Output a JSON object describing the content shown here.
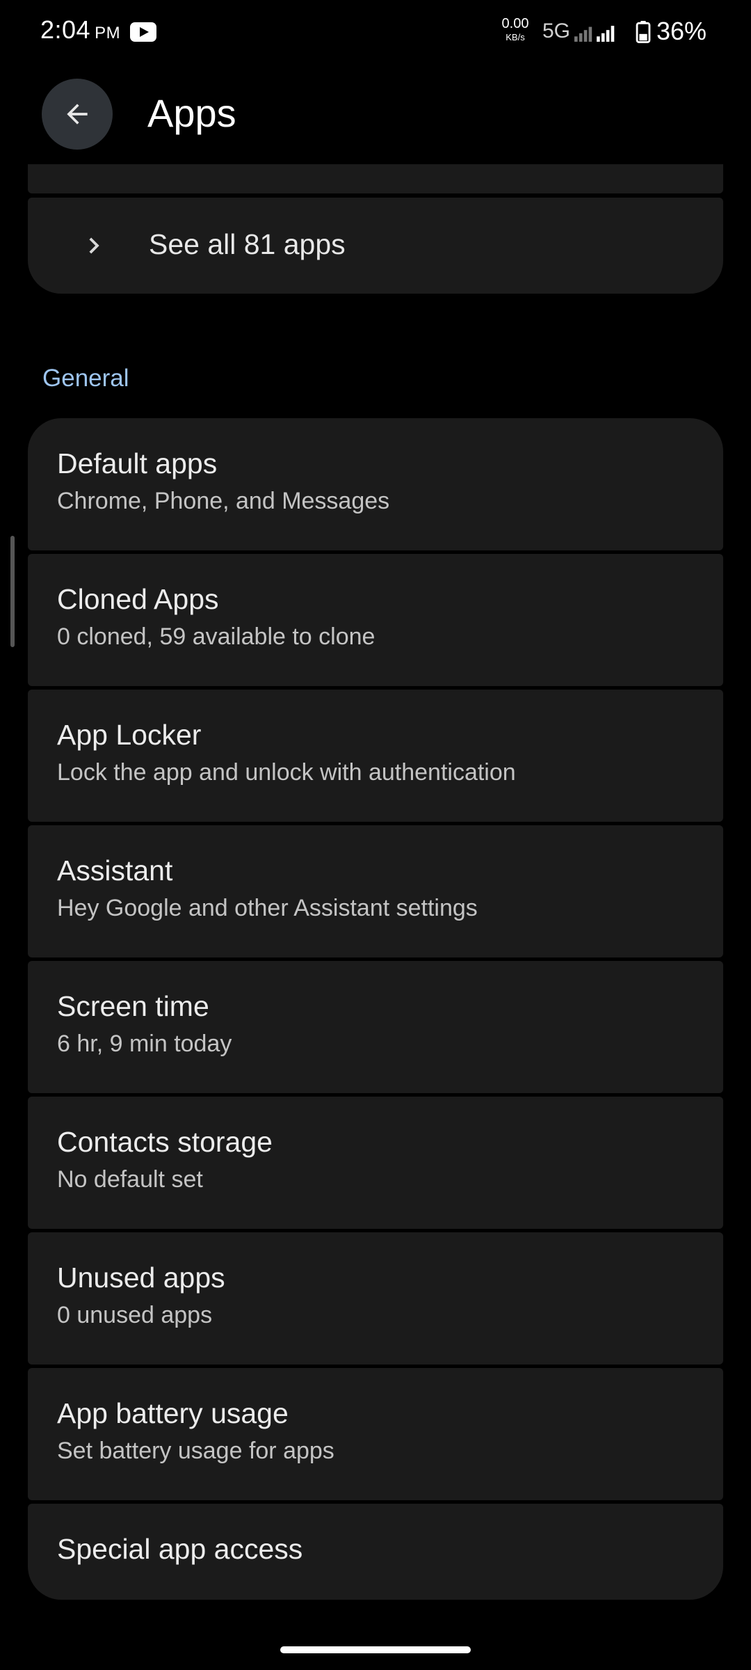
{
  "status_bar": {
    "time": "2:04",
    "ampm": "PM",
    "net_speed_value": "0.00",
    "net_speed_unit": "KB/s",
    "network_type": "5G",
    "battery": "36%"
  },
  "header": {
    "title": "Apps",
    "back_icon": "arrow-left-icon"
  },
  "see_all": {
    "label": "See all 81 apps",
    "icon": "chevron-right-icon"
  },
  "general": {
    "header": "General",
    "items": [
      {
        "title": "Default apps",
        "subtitle": "Chrome, Phone, and Messages"
      },
      {
        "title": "Cloned Apps",
        "subtitle": "0 cloned, 59 available to clone"
      },
      {
        "title": "App Locker",
        "subtitle": "Lock the app and unlock with authentication"
      },
      {
        "title": "Assistant",
        "subtitle": "Hey Google and other Assistant settings"
      },
      {
        "title": "Screen time",
        "subtitle": "6 hr, 9 min today"
      },
      {
        "title": "Contacts storage",
        "subtitle": "No default set"
      },
      {
        "title": "Unused apps",
        "subtitle": "0 unused apps"
      },
      {
        "title": "App battery usage",
        "subtitle": "Set battery usage for apps"
      },
      {
        "title": "Special app access"
      }
    ]
  },
  "colors": {
    "background": "#000000",
    "card": "#1b1b1b",
    "accent": "#9ec5f0",
    "back_button_bg": "#2f3338"
  }
}
